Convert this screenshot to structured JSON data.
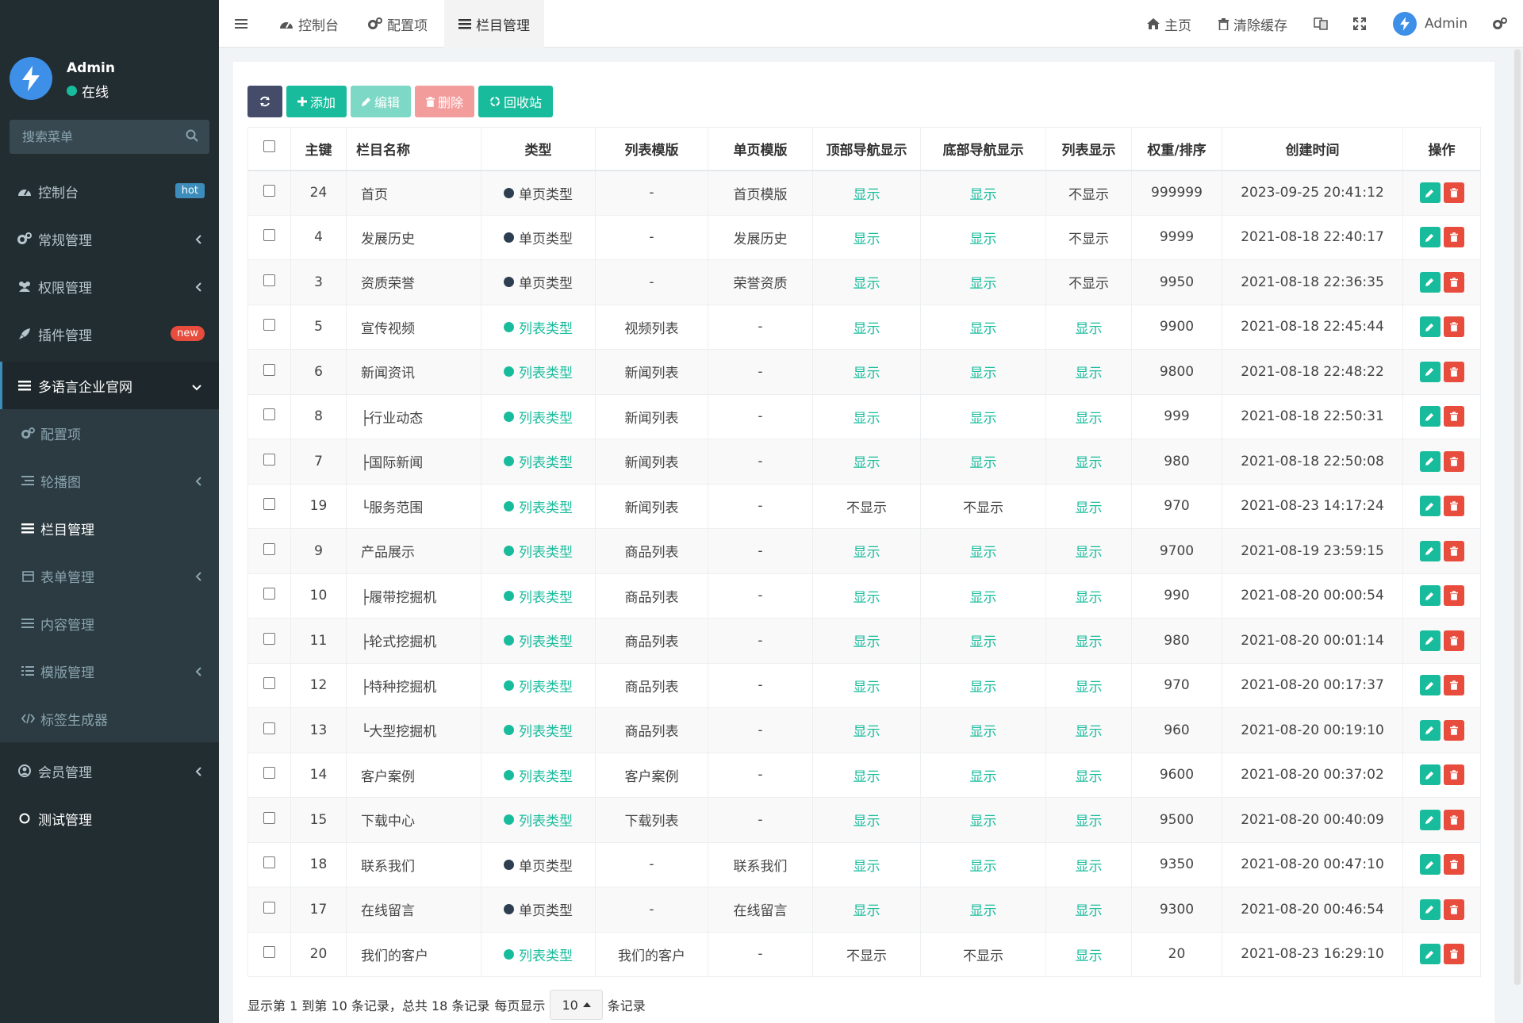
{
  "sidebar": {
    "user": {
      "name": "Admin",
      "status": "在线"
    },
    "search_placeholder": "搜索菜单",
    "menu": [
      {
        "label": "控制台",
        "badge": "hot"
      },
      {
        "label": "常规管理"
      },
      {
        "label": "权限管理"
      },
      {
        "label": "插件管理",
        "badge": "new"
      },
      {
        "label": "多语言企业官网"
      }
    ],
    "submenu": [
      {
        "label": "配置项"
      },
      {
        "label": "轮播图"
      },
      {
        "label": "栏目管理"
      },
      {
        "label": "表单管理"
      },
      {
        "label": "内容管理"
      },
      {
        "label": "模版管理"
      },
      {
        "label": "标签生成器"
      }
    ],
    "menu_bottom": [
      {
        "label": "会员管理"
      },
      {
        "label": "测试管理"
      }
    ]
  },
  "topbar": {
    "tabs": [
      {
        "label": "控制台"
      },
      {
        "label": "配置项"
      },
      {
        "label": "栏目管理"
      }
    ],
    "home": "主页",
    "clear_cache": "清除缓存",
    "user": "Admin"
  },
  "toolbar": {
    "add": "添加",
    "edit": "编辑",
    "delete": "删除",
    "recycle": "回收站"
  },
  "table": {
    "headers": [
      "主键",
      "栏目名称",
      "类型",
      "列表模版",
      "单页模版",
      "顶部导航显示",
      "底部导航显示",
      "列表显示",
      "权重/排序",
      "创建时间",
      "操作"
    ],
    "rows": [
      {
        "id": "24",
        "name": "首页",
        "type": "单页类型",
        "type_kind": "single",
        "list_tpl": "-",
        "page_tpl": "首页模版",
        "top_nav": "显示",
        "bottom_nav": "显示",
        "list_show": "不显示",
        "weight": "999999",
        "created": "2023-09-25 20:41:12"
      },
      {
        "id": "4",
        "name": "发展历史",
        "type": "单页类型",
        "type_kind": "single",
        "list_tpl": "-",
        "page_tpl": "发展历史",
        "top_nav": "显示",
        "bottom_nav": "显示",
        "list_show": "不显示",
        "weight": "9999",
        "created": "2021-08-18 22:40:17"
      },
      {
        "id": "3",
        "name": "资质荣誉",
        "type": "单页类型",
        "type_kind": "single",
        "list_tpl": "-",
        "page_tpl": "荣誉资质",
        "top_nav": "显示",
        "bottom_nav": "显示",
        "list_show": "不显示",
        "weight": "9950",
        "created": "2021-08-18 22:36:35"
      },
      {
        "id": "5",
        "name": "宣传视频",
        "type": "列表类型",
        "type_kind": "list",
        "list_tpl": "视频列表",
        "page_tpl": "-",
        "top_nav": "显示",
        "bottom_nav": "显示",
        "list_show": "显示",
        "weight": "9900",
        "created": "2021-08-18 22:45:44"
      },
      {
        "id": "6",
        "name": "新闻资讯",
        "type": "列表类型",
        "type_kind": "list",
        "list_tpl": "新闻列表",
        "page_tpl": "-",
        "top_nav": "显示",
        "bottom_nav": "显示",
        "list_show": "显示",
        "weight": "9800",
        "created": "2021-08-18 22:48:22"
      },
      {
        "id": "8",
        "name": "├行业动态",
        "type": "列表类型",
        "type_kind": "list",
        "list_tpl": "新闻列表",
        "page_tpl": "-",
        "top_nav": "显示",
        "bottom_nav": "显示",
        "list_show": "显示",
        "weight": "999",
        "created": "2021-08-18 22:50:31"
      },
      {
        "id": "7",
        "name": "├国际新闻",
        "type": "列表类型",
        "type_kind": "list",
        "list_tpl": "新闻列表",
        "page_tpl": "-",
        "top_nav": "显示",
        "bottom_nav": "显示",
        "list_show": "显示",
        "weight": "980",
        "created": "2021-08-18 22:50:08"
      },
      {
        "id": "19",
        "name": "└服务范围",
        "type": "列表类型",
        "type_kind": "list",
        "list_tpl": "新闻列表",
        "page_tpl": "-",
        "top_nav": "不显示",
        "bottom_nav": "不显示",
        "list_show": "显示",
        "weight": "970",
        "created": "2021-08-23 14:17:24"
      },
      {
        "id": "9",
        "name": "产品展示",
        "type": "列表类型",
        "type_kind": "list",
        "list_tpl": "商品列表",
        "page_tpl": "-",
        "top_nav": "显示",
        "bottom_nav": "显示",
        "list_show": "显示",
        "weight": "9700",
        "created": "2021-08-19 23:59:15"
      },
      {
        "id": "10",
        "name": "├履带挖掘机",
        "type": "列表类型",
        "type_kind": "list",
        "list_tpl": "商品列表",
        "page_tpl": "-",
        "top_nav": "显示",
        "bottom_nav": "显示",
        "list_show": "显示",
        "weight": "990",
        "created": "2021-08-20 00:00:54"
      },
      {
        "id": "11",
        "name": "├轮式挖掘机",
        "type": "列表类型",
        "type_kind": "list",
        "list_tpl": "商品列表",
        "page_tpl": "-",
        "top_nav": "显示",
        "bottom_nav": "显示",
        "list_show": "显示",
        "weight": "980",
        "created": "2021-08-20 00:01:14"
      },
      {
        "id": "12",
        "name": "├特种挖掘机",
        "type": "列表类型",
        "type_kind": "list",
        "list_tpl": "商品列表",
        "page_tpl": "-",
        "top_nav": "显示",
        "bottom_nav": "显示",
        "list_show": "显示",
        "weight": "970",
        "created": "2021-08-20 00:17:37"
      },
      {
        "id": "13",
        "name": "└大型挖掘机",
        "type": "列表类型",
        "type_kind": "list",
        "list_tpl": "商品列表",
        "page_tpl": "-",
        "top_nav": "显示",
        "bottom_nav": "显示",
        "list_show": "显示",
        "weight": "960",
        "created": "2021-08-20 00:19:10"
      },
      {
        "id": "14",
        "name": "客户案例",
        "type": "列表类型",
        "type_kind": "list",
        "list_tpl": "客户案例",
        "page_tpl": "-",
        "top_nav": "显示",
        "bottom_nav": "显示",
        "list_show": "显示",
        "weight": "9600",
        "created": "2021-08-20 00:37:02"
      },
      {
        "id": "15",
        "name": "下载中心",
        "type": "列表类型",
        "type_kind": "list",
        "list_tpl": "下载列表",
        "page_tpl": "-",
        "top_nav": "显示",
        "bottom_nav": "显示",
        "list_show": "显示",
        "weight": "9500",
        "created": "2021-08-20 00:40:09"
      },
      {
        "id": "18",
        "name": "联系我们",
        "type": "单页类型",
        "type_kind": "single",
        "list_tpl": "-",
        "page_tpl": "联系我们",
        "top_nav": "显示",
        "bottom_nav": "显示",
        "list_show": "显示",
        "weight": "9350",
        "created": "2021-08-20 00:47:10"
      },
      {
        "id": "17",
        "name": "在线留言",
        "type": "单页类型",
        "type_kind": "single",
        "list_tpl": "-",
        "page_tpl": "在线留言",
        "top_nav": "显示",
        "bottom_nav": "显示",
        "list_show": "显示",
        "weight": "9300",
        "created": "2021-08-20 00:46:54"
      },
      {
        "id": "20",
        "name": "我们的客户",
        "type": "列表类型",
        "type_kind": "list",
        "list_tpl": "我们的客户",
        "page_tpl": "-",
        "top_nav": "不显示",
        "bottom_nav": "不显示",
        "list_show": "显示",
        "weight": "20",
        "created": "2021-08-23 16:29:10"
      }
    ]
  },
  "footer": {
    "summary": "显示第 1 到第 10 条记录，总共 18 条记录",
    "per_page_prefix": "每页显示",
    "per_page_value": "10",
    "per_page_suffix": "条记录"
  },
  "colors": {
    "sidebar_bg": "#222d32",
    "accent_green": "#18bc9c",
    "single_type_dot": "#2c3e50",
    "danger": "#e74c3c",
    "refresh_btn": "#444c69",
    "add_btn": "#18bc9c",
    "edit_btn_disabled": "#7dd8c6",
    "delete_btn_disabled": "#f39c9c"
  }
}
